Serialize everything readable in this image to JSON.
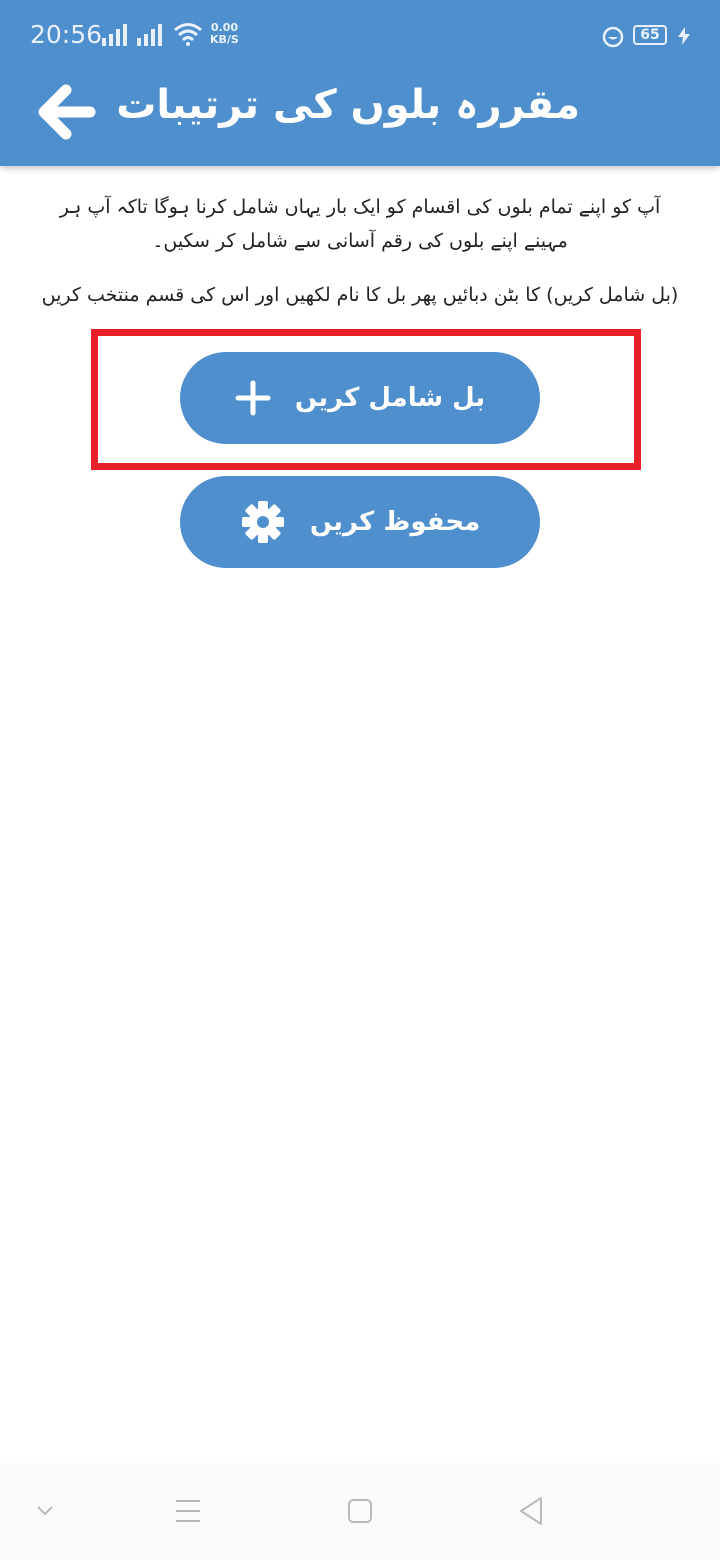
{
  "status_bar": {
    "time": "20:56",
    "net_speed_value": "0.00",
    "net_speed_unit": "KB/S",
    "battery": "65",
    "icons": [
      "signal-icon",
      "signal-icon",
      "wifi-icon",
      "bubble-icon",
      "charging-icon"
    ]
  },
  "header": {
    "title": "مقررہ بلوں کی ترتیبات",
    "back_icon": "arrow-left-icon"
  },
  "content": {
    "description": "آپ کو اپنے تمام بلوں کی اقسام کو ایک بار یہاں شامل کرنا ہوگا تاکہ آپ ہر مہینے اپنے بلوں کی رقم آسانی سے شامل کر سکیں۔",
    "instruction": "(بل شامل کریں) کا بٹن دبائیں پھر بل کا نام لکھیں اور اس کی قسم منتخب کریں"
  },
  "buttons": {
    "add_bill": {
      "label": "بل شامل کریں",
      "icon": "plus-icon"
    },
    "save": {
      "label": "محفوظ کریں",
      "icon": "gear-icon"
    }
  },
  "nav_bar": {
    "icons": [
      "chevron-down-icon",
      "menu-icon",
      "home-icon",
      "back-triangle-icon"
    ]
  },
  "colors": {
    "primary": "#4f8fce",
    "highlight": "#e8202a",
    "text": "#222222"
  }
}
